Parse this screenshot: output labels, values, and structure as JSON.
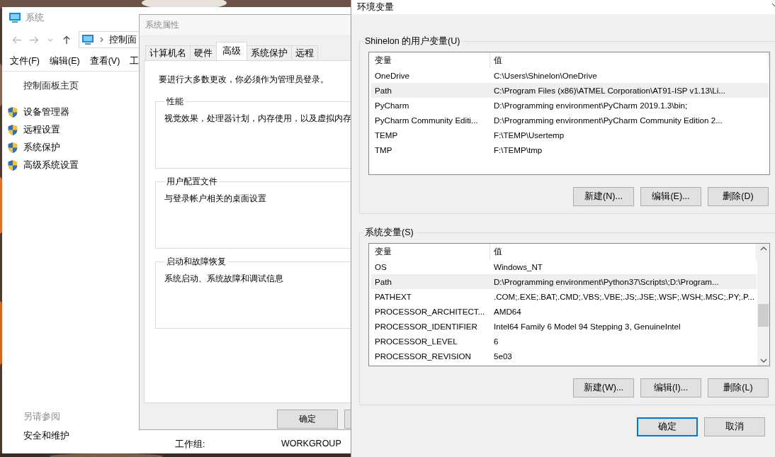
{
  "system_window": {
    "title": "系统",
    "address": "控制面",
    "menu": [
      "文件(F)",
      "编辑(E)",
      "查看(V)",
      "工"
    ],
    "home_link": "控制面板主页",
    "tasks": [
      "设备管理器",
      "远程设置",
      "系统保护",
      "高级系统设置"
    ],
    "see_also": {
      "heading": "另请参阅",
      "links": [
        "安全和维护"
      ]
    },
    "workgroup": {
      "label": "工作组:",
      "value": "WORKGROUP"
    }
  },
  "properties_dialog": {
    "title": "系统属性",
    "tabs": [
      {
        "label": "计算机名",
        "selected": false
      },
      {
        "label": "硬件",
        "selected": false
      },
      {
        "label": "高级",
        "selected": true
      },
      {
        "label": "系统保护",
        "selected": false
      },
      {
        "label": "远程",
        "selected": false
      }
    ],
    "notice": "要进行大多数更改，你必须作为管理员登录。",
    "groups": [
      {
        "title": "性能",
        "description": "视觉效果，处理器计划，内存使用，以及虚拟内存"
      },
      {
        "title": "用户配置文件",
        "description": "与登录帐户相关的桌面设置"
      },
      {
        "title": "启动和故障恢复",
        "description": "系统启动、系统故障和调试信息"
      }
    ],
    "buttons": [
      "确定"
    ]
  },
  "env_dialog": {
    "title": "环境变量",
    "sections": [
      {
        "title": "Shinelon 的用户变量(U)",
        "columns": [
          "变量",
          "值"
        ],
        "scrollable": false,
        "rows": [
          {
            "name": "OneDrive",
            "value": "C:\\Users\\Shinelon\\OneDrive",
            "selected": false
          },
          {
            "name": "Path",
            "value": "C:\\Program Files (x86)\\ATMEL Corporation\\AT91-ISP v1.13\\Li...",
            "selected": true
          },
          {
            "name": "PyCharm",
            "value": "D:\\Programming environment\\PyCharm 2019.1.3\\bin;",
            "selected": false
          },
          {
            "name": "PyCharm Community Editi...",
            "value": "D:\\Programming environment\\PyCharm Community Edition 2...",
            "selected": false
          },
          {
            "name": "TEMP",
            "value": "F:\\TEMP\\Usertemp",
            "selected": false
          },
          {
            "name": "TMP",
            "value": "F:\\TEMP\\tmp",
            "selected": false
          }
        ],
        "buttons": [
          "新建(N)...",
          "编辑(E)...",
          "删除(D)"
        ]
      },
      {
        "title": "系统变量(S)",
        "columns": [
          "变量",
          "值"
        ],
        "scrollable": true,
        "rows": [
          {
            "name": "OS",
            "value": "Windows_NT",
            "selected": false
          },
          {
            "name": "Path",
            "value": "D:\\Programming environment\\Python37\\Scripts\\;D:\\Program...",
            "selected": true
          },
          {
            "name": "PATHEXT",
            "value": ".COM;.EXE;.BAT;.CMD;.VBS;.VBE;.JS;.JSE;.WSF;.WSH;.MSC;.PY;.P...",
            "selected": false
          },
          {
            "name": "PROCESSOR_ARCHITECT...",
            "value": "AMD64",
            "selected": false
          },
          {
            "name": "PROCESSOR_IDENTIFIER",
            "value": "Intel64 Family 6 Model 94 Stepping 3, GenuineIntel",
            "selected": false
          },
          {
            "name": "PROCESSOR_LEVEL",
            "value": "6",
            "selected": false
          },
          {
            "name": "PROCESSOR_REVISION",
            "value": "5e03",
            "selected": false
          }
        ],
        "buttons": [
          "新建(W)...",
          "编辑(I)...",
          "删除(L)"
        ]
      }
    ],
    "buttons": [
      {
        "label": "确定",
        "default": true
      },
      {
        "label": "取消",
        "default": false
      }
    ]
  }
}
